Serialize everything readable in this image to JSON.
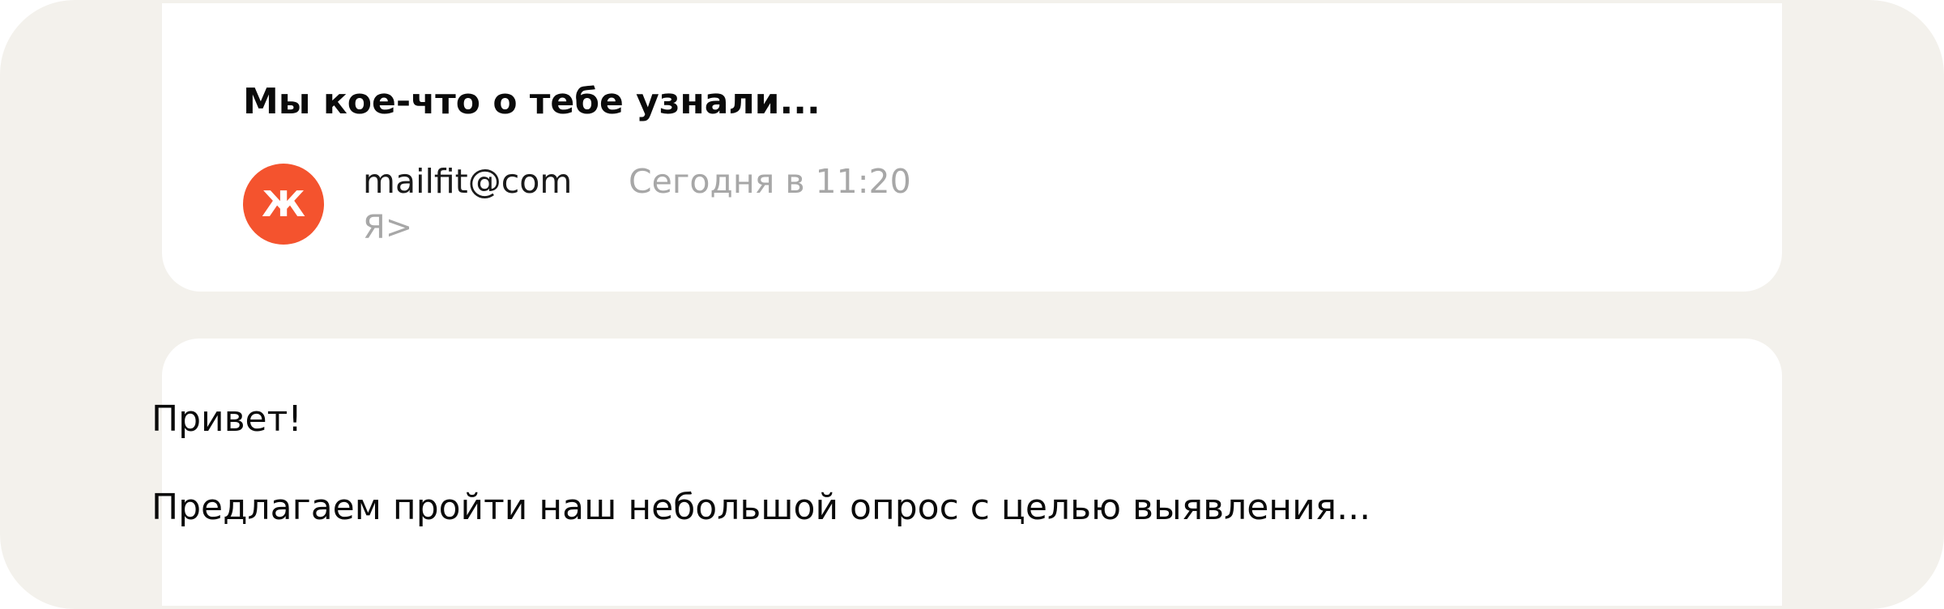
{
  "email": {
    "subject": "Мы кое-что о тебе узнали...",
    "avatar": {
      "letter": "Ж",
      "color": "#f4532e"
    },
    "sender": "mailfit@com",
    "time": "Сегодня в 11:20",
    "recipient": "Я>",
    "body": {
      "greeting": "Привет!",
      "text": "Предлагаем пройти наш небольшой опрос с целью выявления..."
    }
  },
  "colors": {
    "background": "#f3f1ec",
    "card": "#ffffff",
    "muted_text": "#a7a7a7",
    "primary_text": "#0a0a0a"
  }
}
